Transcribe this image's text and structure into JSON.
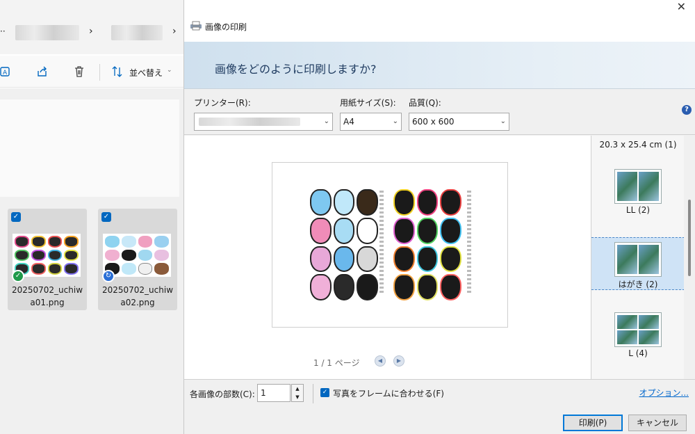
{
  "explorer": {
    "toolbar": {
      "sort_label": "並べ替え"
    },
    "files": [
      {
        "name": "20250702_uchiwa01.png",
        "status": "synced"
      },
      {
        "name": "20250702_uchiwa02.png",
        "status": "syncing"
      }
    ]
  },
  "dialog": {
    "title": "画像の印刷",
    "header": "画像をどのように印刷しますか?",
    "printer_label": "プリンター(R):",
    "paper_label": "用紙サイズ(S):",
    "paper_value": "A4",
    "quality_label": "品質(Q):",
    "quality_value": "600 x 600",
    "pager": "1 / 1 ページ",
    "sizes": [
      {
        "label": "20.3 x 25.4 cm (1)",
        "selected": false
      },
      {
        "label": "LL (2)",
        "selected": false
      },
      {
        "label": "はがき (2)",
        "selected": true
      },
      {
        "label": "L (4)",
        "selected": false
      }
    ],
    "copies_label": "各画像の部数(C):",
    "copies_value": "1",
    "fit_label": "写真をフレームに合わせる(F)",
    "fit_checked": true,
    "options_link": "オプション...",
    "print_button": "印刷(P)",
    "cancel_button": "キャンセル"
  },
  "colors": {
    "accent": "#0067c0",
    "header_bg": "#dce8f2",
    "selected_size": "#cfe3f6"
  }
}
